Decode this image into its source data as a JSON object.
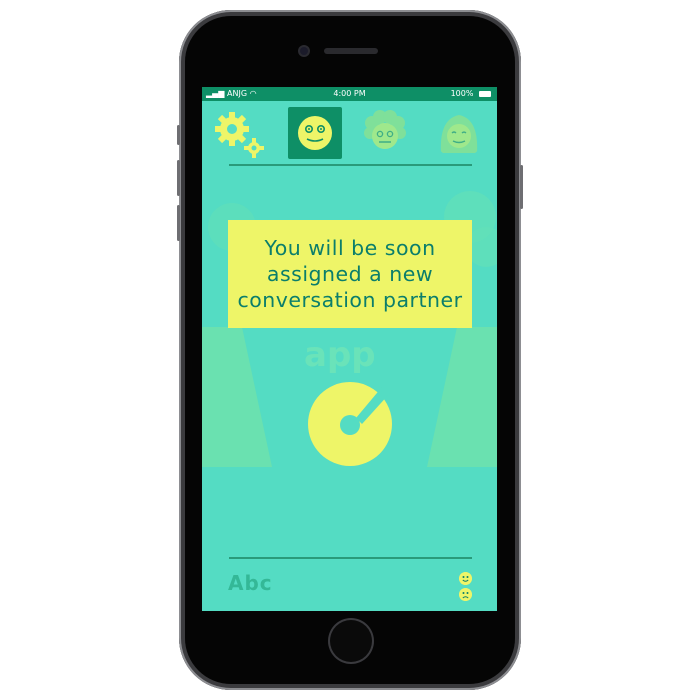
{
  "status_bar": {
    "carrier": "ANJG",
    "time": "4:00 PM",
    "battery": "100%"
  },
  "toolbar": {
    "settings_icon": "gear-icon",
    "avatars": [
      {
        "icon": "smiley-avatar-icon",
        "selected": true
      },
      {
        "icon": "curly-hair-avatar-icon",
        "selected": false
      },
      {
        "icon": "long-hair-avatar-icon",
        "selected": false
      }
    ]
  },
  "main": {
    "message": "You will be soon assigned a new conversation partner",
    "watermark_text": "app"
  },
  "input": {
    "value": "Abc"
  },
  "mood_buttons": [
    {
      "icon": "happy-face-icon"
    },
    {
      "icon": "sad-face-icon"
    }
  ],
  "colors": {
    "screen_bg": "#54dcc3",
    "status_bar": "#0e8f66",
    "accent_yellow": "#eef568",
    "text_teal": "#0b7e6b"
  }
}
